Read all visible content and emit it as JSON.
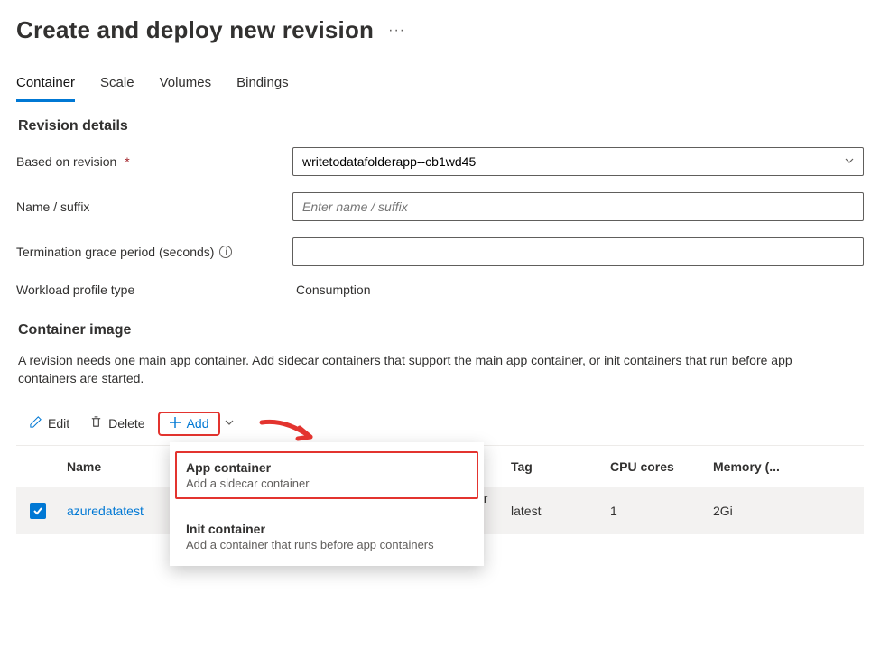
{
  "page": {
    "title": "Create and deploy new revision"
  },
  "tabs": [
    {
      "id": "container",
      "label": "Container",
      "active": true
    },
    {
      "id": "scale",
      "label": "Scale",
      "active": false
    },
    {
      "id": "volumes",
      "label": "Volumes",
      "active": false
    },
    {
      "id": "bindings",
      "label": "Bindings",
      "active": false
    }
  ],
  "revision": {
    "heading": "Revision details",
    "based_on_label": "Based on revision",
    "based_on_value": "writetodatafolderapp--cb1wd45",
    "name_label": "Name / suffix",
    "name_placeholder": "Enter name / suffix",
    "termination_label": "Termination grace period (seconds)",
    "workload_label": "Workload profile type",
    "workload_value": "Consumption"
  },
  "image": {
    "heading": "Container image",
    "description": "A revision needs one main app container. Add sidecar containers that support the main app container, or init containers that run before app containers are started."
  },
  "toolbar": {
    "edit": "Edit",
    "delete": "Delete",
    "add": "Add"
  },
  "add_menu": [
    {
      "title": "App container",
      "subtitle": "Add a sidecar container",
      "highlight": true
    },
    {
      "title": "Init container",
      "subtitle": "Add a container that runs before app containers",
      "highlight": false
    }
  ],
  "table": {
    "headers": {
      "name": "Name",
      "tag": "Tag",
      "cpu": "CPU cores",
      "mem": "Memory (..."
    },
    "rows": [
      {
        "checked": true,
        "name": "azuredatatest",
        "name_trunc_tail": "er",
        "tag": "latest",
        "cpu": "1",
        "mem": "2Gi"
      }
    ]
  }
}
